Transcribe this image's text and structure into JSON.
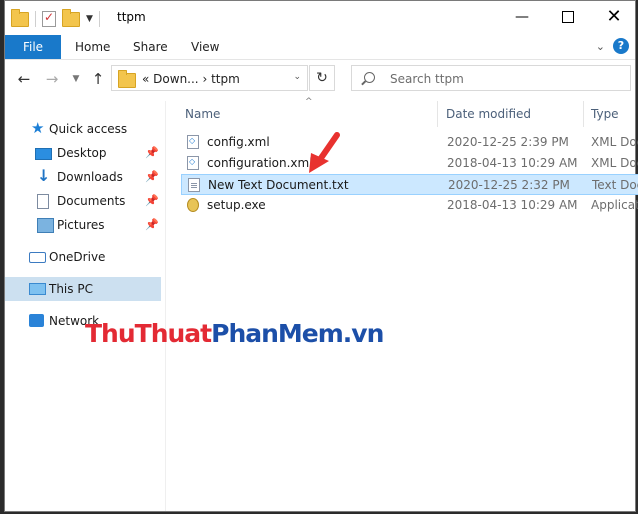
{
  "window": {
    "title": "ttpm",
    "controls": {
      "minimize": "—",
      "close": "✕"
    }
  },
  "ribbon": {
    "file": "File",
    "tabs": [
      "Home",
      "Share",
      "View"
    ]
  },
  "address": {
    "prefix": "«",
    "path": [
      "Down...",
      "ttpm"
    ],
    "separator": "›"
  },
  "search": {
    "placeholder": "Search ttpm"
  },
  "nav_pane": {
    "quick_access": "Quick access",
    "items": [
      {
        "label": "Desktop",
        "icon": "desktop-icon"
      },
      {
        "label": "Downloads",
        "icon": "downloads-icon"
      },
      {
        "label": "Documents",
        "icon": "documents-icon"
      },
      {
        "label": "Pictures",
        "icon": "pictures-icon"
      }
    ],
    "onedrive": "OneDrive",
    "this_pc": "This PC",
    "network": "Network"
  },
  "columns": {
    "name": "Name",
    "date": "Date modified",
    "type": "Type"
  },
  "files": [
    {
      "name": "config.xml",
      "date": "2020-12-25 2:39 PM",
      "type": "XML Docu"
    },
    {
      "name": "configuration.xml",
      "date": "2018-04-13 10:29 AM",
      "type": "XML Docu"
    },
    {
      "name": "New Text Document.txt",
      "date": "2020-12-25 2:32 PM",
      "type": "Text Docu"
    },
    {
      "name": "setup.exe",
      "date": "2018-04-13 10:29 AM",
      "type": "Applicatio"
    }
  ],
  "selected_file": "New Text Document.txt",
  "watermark": {
    "part1": "ThuThuat",
    "part2": "PhanMem",
    "part3": ".vn"
  },
  "colors": {
    "accent": "#1979ca",
    "selection": "#cce8ff",
    "annotation_arrow": "#e8322f"
  }
}
